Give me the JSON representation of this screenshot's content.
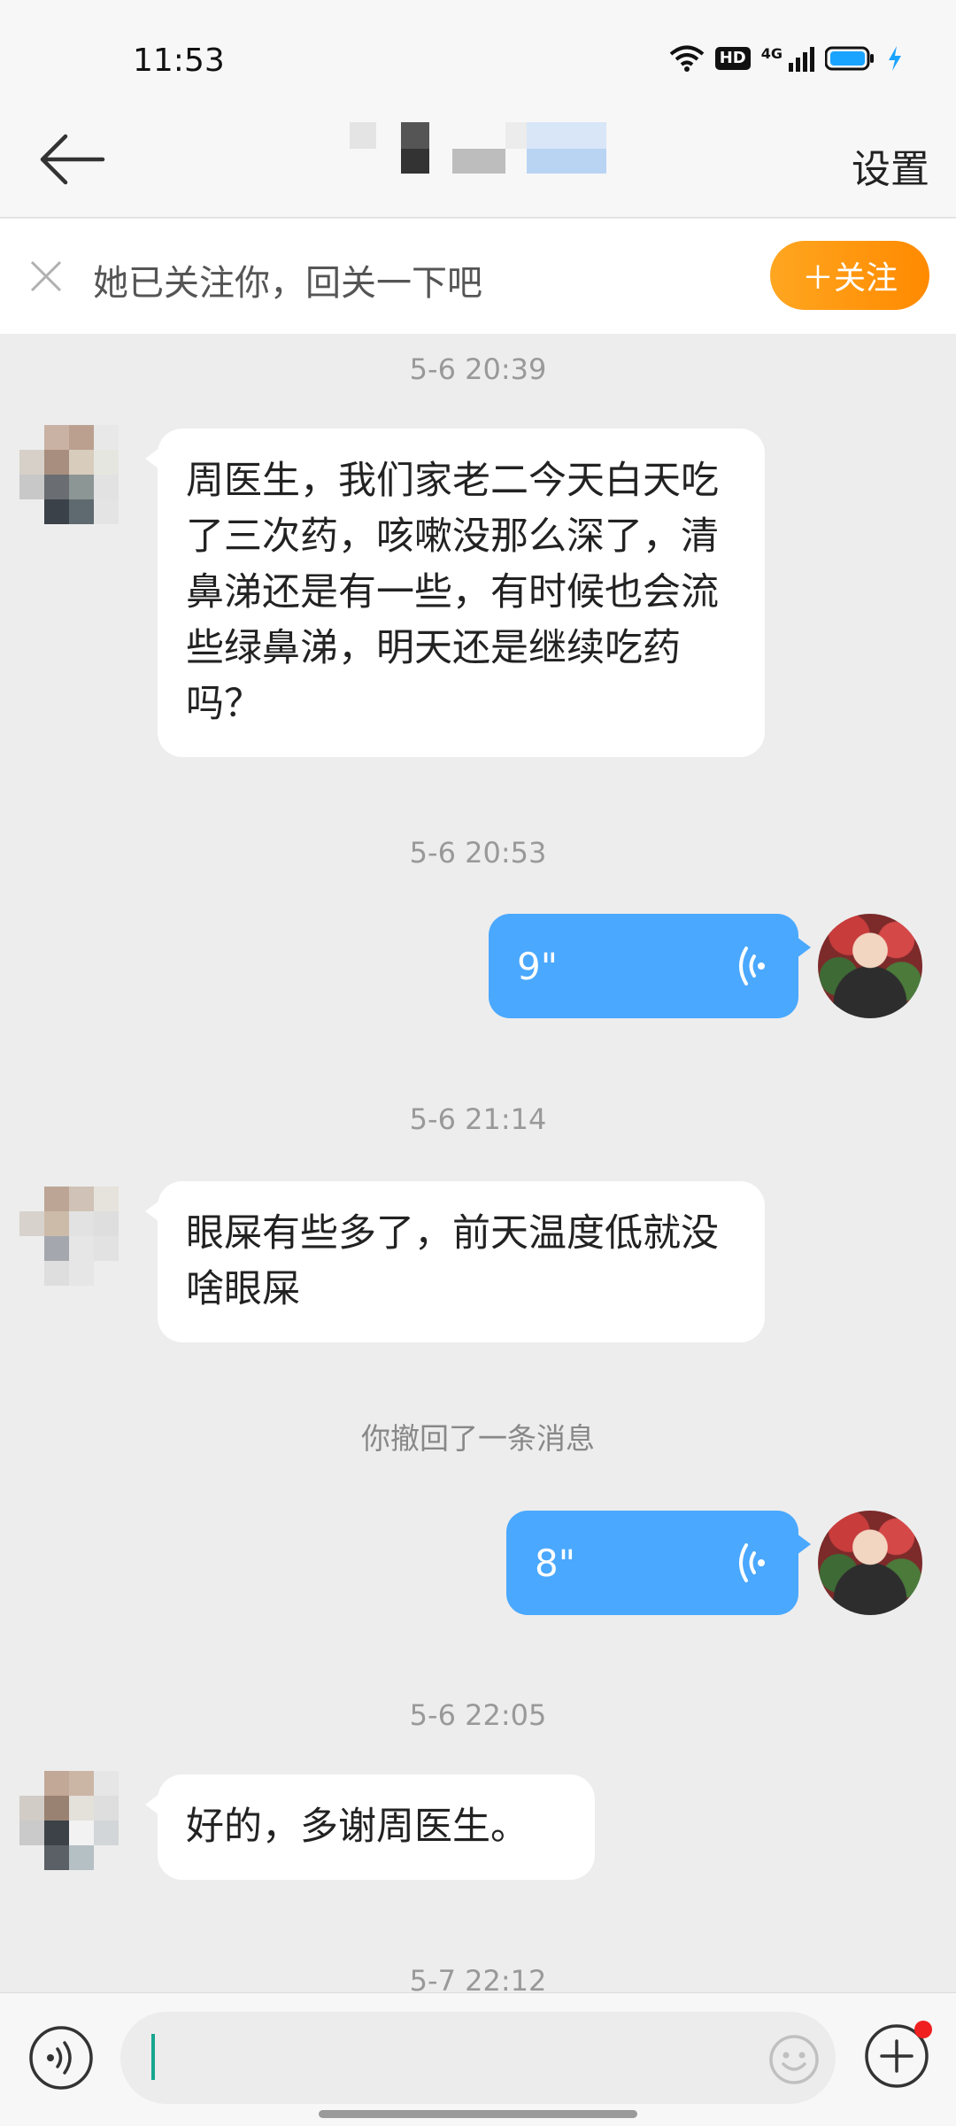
{
  "status_bar": {
    "time": "11:53",
    "hd_badge": "HD",
    "network": "4G",
    "battery_color": "#1aa3ff"
  },
  "header": {
    "back_icon": "arrow-left-icon",
    "settings_label": "设置"
  },
  "follow_bar": {
    "message": "她已关注你，回关一下吧",
    "follow_label": "＋关注",
    "accent_color": "#ff9a10"
  },
  "messages": [
    {
      "timestamp": "5-6 20:39",
      "side": "left",
      "type": "text",
      "text": "周医生，我们家老二今天白天吃了三次药，咳嗽没那么深了，清鼻涕还是有一些，有时候也会流些绿鼻涕，明天还是继续吃药吗？"
    },
    {
      "timestamp": "5-6 20:53",
      "side": "right",
      "type": "voice",
      "duration": "9\""
    },
    {
      "timestamp": "5-6 21:14",
      "side": "left",
      "type": "text",
      "text": "眼屎有些多了，前天温度低就没啥眼屎"
    },
    {
      "side": "system",
      "type": "recall",
      "text": "你撤回了一条消息"
    },
    {
      "side": "right",
      "type": "voice",
      "duration": "8\""
    },
    {
      "timestamp": "5-6 22:05",
      "side": "left",
      "type": "text",
      "text": "好的，多谢周医生。"
    },
    {
      "timestamp": "5-7 22:12"
    }
  ],
  "input_bar": {
    "voice_icon": "voice-toggle-icon",
    "emoji_icon": "emoji-icon",
    "plus_icon": "plus-icon",
    "voice_bubble_color": "#4aa8ff"
  }
}
